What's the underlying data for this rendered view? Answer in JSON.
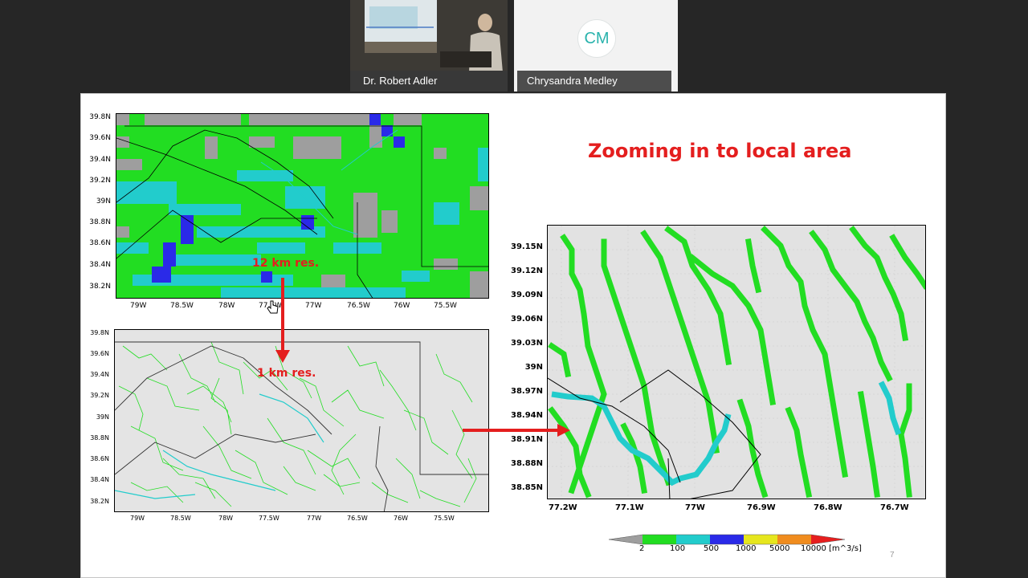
{
  "participants": [
    {
      "name": "Dr. Robert Adler",
      "kind": "video"
    },
    {
      "name": "Chrysandra Medley",
      "initials": "CM",
      "kind": "avatar"
    }
  ],
  "slide": {
    "title": "Zooming in to local area",
    "page_number": "7",
    "annotations": {
      "coarse": "12 km res.",
      "fine": "1 km res."
    }
  },
  "map_top": {
    "y_ticks": [
      "39.8N",
      "39.6N",
      "39.4N",
      "39.2N",
      "39N",
      "38.8N",
      "38.6N",
      "38.4N",
      "38.2N"
    ],
    "x_ticks": [
      "79W",
      "78.5W",
      "78W",
      "77.5W",
      "77W",
      "76.5W",
      "76W",
      "75.5W"
    ]
  },
  "map_bottom": {
    "y_ticks": [
      "39.8N",
      "39.6N",
      "39.4N",
      "39.2N",
      "39N",
      "38.8N",
      "38.6N",
      "38.4N",
      "38.2N"
    ],
    "x_ticks": [
      "79W",
      "78.5W",
      "78W",
      "77.5W",
      "77W",
      "76.5W",
      "76W",
      "75.5W"
    ]
  },
  "map_zoom": {
    "y_ticks": [
      "39.15N",
      "39.12N",
      "39.09N",
      "39.06N",
      "39.03N",
      "39N",
      "38.97N",
      "38.94N",
      "38.91N",
      "38.88N",
      "38.85N"
    ],
    "x_ticks": [
      "77.2W",
      "77.1W",
      "77W",
      "76.9W",
      "76.8W",
      "76.7W"
    ]
  },
  "legend": {
    "labels": [
      "2",
      "100",
      "500",
      "1000",
      "5000",
      "10000 [m^3/s]"
    ],
    "colors": [
      "#9e9e9e",
      "#22dd22",
      "#22cccc",
      "#2a2ae8",
      "#e6e61e",
      "#f08c1e",
      "#e61e1e"
    ]
  },
  "colors": {
    "title_red": "#e41e1e",
    "river_green": "#22dd22",
    "river_cyan": "#22cccc",
    "grid_gray": "#9e9e9e"
  }
}
